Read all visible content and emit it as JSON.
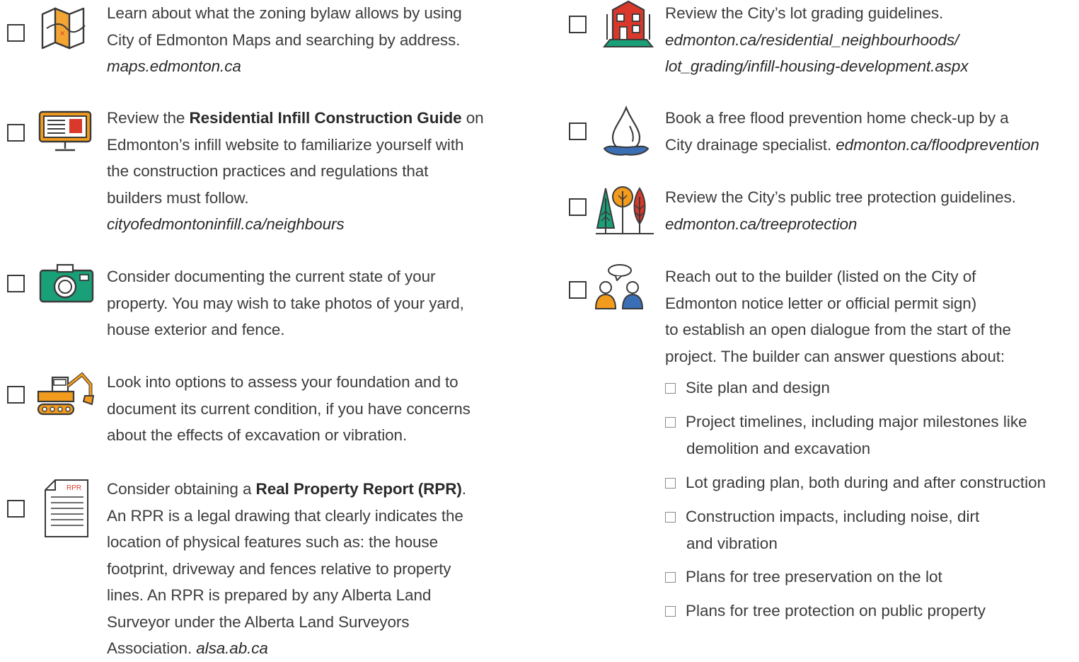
{
  "left": {
    "zoning": {
      "lines": [
        "Learn about what the zoning bylaw allows by using",
        "City of Edmonton Maps and searching by address."
      ],
      "link": "maps.edmonton.ca",
      "icon": "map-icon"
    },
    "infill_guide": {
      "prefix": "Review the ",
      "bold": "Residential Infill Construction Guide",
      "suffix": " on",
      "lines": [
        "Edmonton’s infill website to familiarize yourself with",
        "the construction practices and regulations that",
        "builders must follow."
      ],
      "link": "cityofedmontoninfill.ca/neighbours",
      "icon": "monitor-icon"
    },
    "photos": {
      "lines": [
        "Consider documenting the current state of your",
        "property.  You may wish to take photos of your yard,",
        "house exterior and fence."
      ],
      "icon": "camera-icon"
    },
    "foundation": {
      "lines": [
        "Look into options to assess your foundation and to",
        "document its current condition, if you have concerns",
        "about the effects of excavation or vibration."
      ],
      "icon": "excavator-icon"
    },
    "rpr": {
      "prefix": "Consider obtaining a ",
      "bold": "Real Property Report (RPR)",
      "suffix": ".",
      "lines": [
        "An RPR is a legal drawing that clearly indicates the",
        "location of physical features such as: the house",
        "footprint, driveway and fences relative to property",
        "lines. An RPR is prepared by any Alberta Land",
        "Surveyor under the Alberta Land Surveyors"
      ],
      "last_prefix": "Association. ",
      "link": "alsa.ab.ca",
      "icon": "document-icon",
      "icon_label": "RPR"
    }
  },
  "right": {
    "lot_grading": {
      "line": "Review the City’s lot grading guidelines.",
      "links": [
        "edmonton.ca/residential_neighbourhoods/",
        "lot_grading/infill-housing-development.aspx"
      ],
      "icon": "house-icon"
    },
    "flood": {
      "line1": "Book a free flood prevention home check-up by a",
      "line2_prefix": "City drainage specialist. ",
      "link": "edmonton.ca/floodprevention",
      "icon": "water-drop-icon"
    },
    "trees": {
      "line": "Review the City’s public tree protection guidelines.",
      "link": "edmonton.ca/treeprotection",
      "icon": "trees-icon"
    },
    "builder": {
      "lines": [
        "Reach out to the builder (listed on the City of",
        "Edmonton notice letter or official permit sign)",
        "to establish an open dialogue from the start of the",
        "project. The builder can answer questions about:"
      ],
      "icon": "people-chat-icon",
      "subitems": [
        {
          "lines": [
            "Site plan and design"
          ]
        },
        {
          "lines": [
            "Project timelines, including major milestones like",
            "demolition and excavation"
          ]
        },
        {
          "lines": [
            "Lot grading plan, both during and after construction"
          ]
        },
        {
          "lines": [
            "Construction impacts, including noise, dirt",
            "and vibration"
          ]
        },
        {
          "lines": [
            "Plans for tree preservation on the lot"
          ]
        },
        {
          "lines": [
            "Plans for tree protection on public property"
          ]
        }
      ]
    }
  },
  "colors": {
    "orange": "#f29b1d",
    "green": "#1aa078",
    "red": "#d9382b",
    "blue": "#3a6fb5",
    "dark": "#3a3a3a"
  }
}
